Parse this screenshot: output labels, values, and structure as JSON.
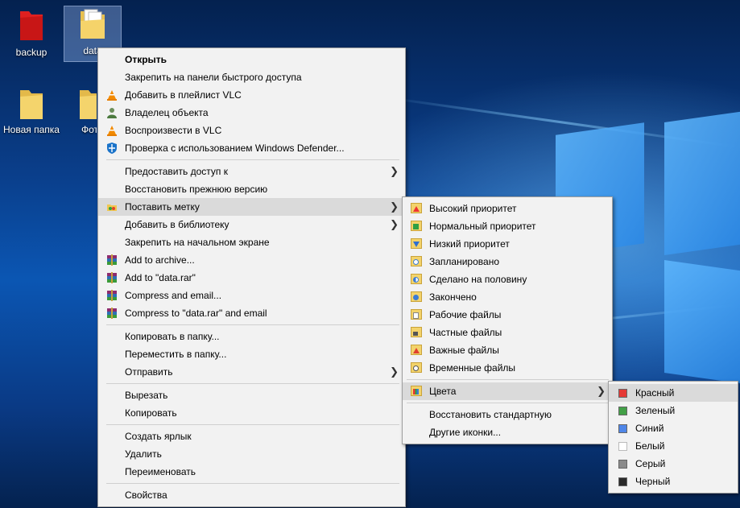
{
  "desktop": {
    "icons": [
      {
        "label": "backup"
      },
      {
        "label": "data"
      },
      {
        "label": "Новая папка"
      },
      {
        "label": "Фото"
      }
    ]
  },
  "context_menu": {
    "items": [
      {
        "label": "Открыть"
      },
      {
        "label": "Закрепить на панели быстрого доступа"
      },
      {
        "label": "Добавить в плейлист VLC"
      },
      {
        "label": "Владелец объекта"
      },
      {
        "label": "Воспроизвести в VLC"
      },
      {
        "label": "Проверка с использованием Windows Defender..."
      },
      {
        "label": "Предоставить доступ к"
      },
      {
        "label": "Восстановить прежнюю версию"
      },
      {
        "label": "Поставить метку"
      },
      {
        "label": "Добавить в библиотеку"
      },
      {
        "label": "Закрепить на начальном экране"
      },
      {
        "label": "Add to archive..."
      },
      {
        "label": "Add to \"data.rar\""
      },
      {
        "label": "Compress and email..."
      },
      {
        "label": "Compress to \"data.rar\" and email"
      },
      {
        "label": "Копировать в папку..."
      },
      {
        "label": "Переместить в папку..."
      },
      {
        "label": "Отправить"
      },
      {
        "label": "Вырезать"
      },
      {
        "label": "Копировать"
      },
      {
        "label": "Создать ярлык"
      },
      {
        "label": "Удалить"
      },
      {
        "label": "Переименовать"
      },
      {
        "label": "Свойства"
      }
    ]
  },
  "label_submenu": {
    "items": [
      {
        "label": "Высокий приоритет"
      },
      {
        "label": "Нормальный приоритет"
      },
      {
        "label": "Низкий приоритет"
      },
      {
        "label": "Запланировано"
      },
      {
        "label": "Сделано на половину"
      },
      {
        "label": "Закончено"
      },
      {
        "label": "Рабочие файлы"
      },
      {
        "label": "Частные файлы"
      },
      {
        "label": "Важные файлы"
      },
      {
        "label": "Временные файлы"
      },
      {
        "label": "Цвета"
      },
      {
        "label": "Восстановить стандартную"
      },
      {
        "label": "Другие иконки..."
      }
    ]
  },
  "colors_submenu": {
    "items": [
      {
        "label": "Красный",
        "color": "#e53935"
      },
      {
        "label": "Зеленый",
        "color": "#43a047"
      },
      {
        "label": "Синий",
        "color": "#4f86e8"
      },
      {
        "label": "Белый",
        "color": "#ffffff"
      },
      {
        "label": "Серый",
        "color": "#8a8a8a"
      },
      {
        "label": "Черный",
        "color": "#2a2a2a"
      }
    ]
  }
}
